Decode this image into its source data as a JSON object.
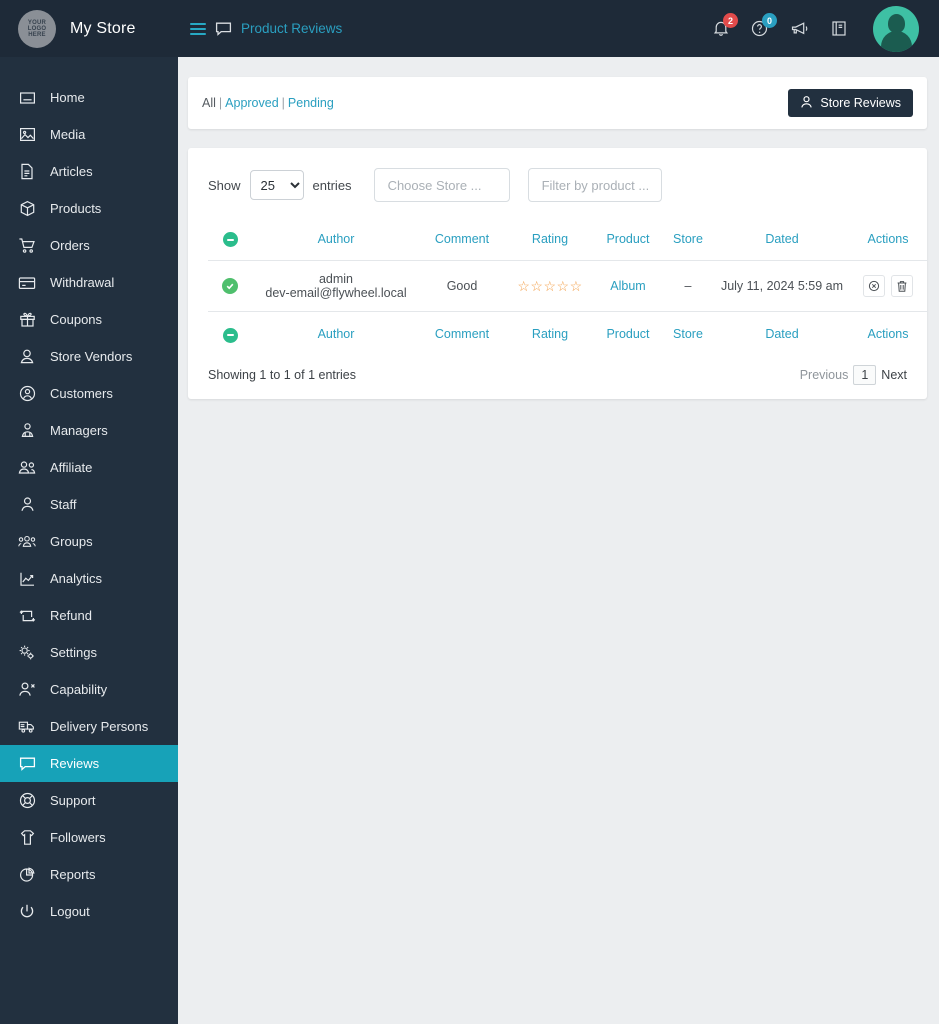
{
  "topbar": {
    "logo_text_lines": [
      "YOUR",
      "LOGO",
      "HERE"
    ],
    "brand_name": "My Store",
    "menu_icon": "hamburger-icon",
    "page_icon": "speech-bubble-icon",
    "page_title": "Product Reviews",
    "notifications_badge": "2",
    "help_badge": "0",
    "icons": [
      "bell-icon",
      "help-circle-icon",
      "megaphone-icon",
      "book-icon",
      "avatar"
    ]
  },
  "sidebar": {
    "items": [
      {
        "label": "Home",
        "icon": "home-icon",
        "active": false
      },
      {
        "label": "Media",
        "icon": "image-icon",
        "active": false
      },
      {
        "label": "Articles",
        "icon": "document-icon",
        "active": false
      },
      {
        "label": "Products",
        "icon": "box-icon",
        "active": false
      },
      {
        "label": "Orders",
        "icon": "cart-icon",
        "active": false
      },
      {
        "label": "Withdrawal",
        "icon": "credit-card-icon",
        "active": false
      },
      {
        "label": "Coupons",
        "icon": "gift-icon",
        "active": false
      },
      {
        "label": "Store Vendors",
        "icon": "user-icon",
        "active": false
      },
      {
        "label": "Customers",
        "icon": "user-circle-icon",
        "active": false
      },
      {
        "label": "Managers",
        "icon": "manager-icon",
        "active": false
      },
      {
        "label": "Affiliate",
        "icon": "users-icon",
        "active": false
      },
      {
        "label": "Staff",
        "icon": "user-outline-icon",
        "active": false
      },
      {
        "label": "Groups",
        "icon": "group-icon",
        "active": false
      },
      {
        "label": "Analytics",
        "icon": "chart-icon",
        "active": false
      },
      {
        "label": "Refund",
        "icon": "refund-arrow-icon",
        "active": false
      },
      {
        "label": "Settings",
        "icon": "gears-icon",
        "active": false
      },
      {
        "label": "Capability",
        "icon": "user-x-icon",
        "active": false
      },
      {
        "label": "Delivery Persons",
        "icon": "truck-icon",
        "active": false
      },
      {
        "label": "Reviews",
        "icon": "comment-icon",
        "active": true
      },
      {
        "label": "Support",
        "icon": "lifebuoy-icon",
        "active": false
      },
      {
        "label": "Followers",
        "icon": "shirt-icon",
        "active": false
      },
      {
        "label": "Reports",
        "icon": "pie-chart-icon",
        "active": false
      },
      {
        "label": "Logout",
        "icon": "power-icon",
        "active": false
      }
    ]
  },
  "filterbar": {
    "status_all": "All",
    "status_approved": "Approved",
    "status_pending": "Pending",
    "separator": "|",
    "store_reviews_button": "Store Reviews",
    "store_reviews_icon": "person-icon"
  },
  "controls": {
    "show_label": "Show",
    "entries_label": "entries",
    "page_length_value": "25",
    "page_length_options": [
      "25"
    ],
    "store_filter_placeholder": "Choose Store ...",
    "product_filter_placeholder": "Filter by product ..."
  },
  "table": {
    "columns": [
      "",
      "Author",
      "Comment",
      "Rating",
      "Product",
      "Store",
      "Dated",
      "Actions"
    ],
    "header_flag_icon": "status-dot-icon",
    "rows": [
      {
        "status_icon": "check-circle-icon",
        "author_name": "admin",
        "author_email": "dev-email@flywheel.local",
        "comment": "Good",
        "rating": 0,
        "rating_max": 5,
        "rating_stars": "☆☆☆☆☆",
        "product": "Album",
        "store": "–",
        "dated": "July 11, 2024 5:59 am",
        "actions": [
          "unapprove-button",
          "delete-button"
        ]
      }
    ]
  },
  "footer": {
    "showing_text": "Showing 1 to 1 of 1 entries",
    "previous_label": "Previous",
    "page_number": "1",
    "next_label": "Next"
  },
  "colors": {
    "sidebar_bg": "#22303f",
    "topbar_bg": "#1e2a38",
    "accent_teal": "#17a2b8",
    "link_teal": "#2a9fc0",
    "star_orange": "#f3a04b",
    "status_green": "#4fbf6d",
    "badge_red": "#e24b4b"
  }
}
